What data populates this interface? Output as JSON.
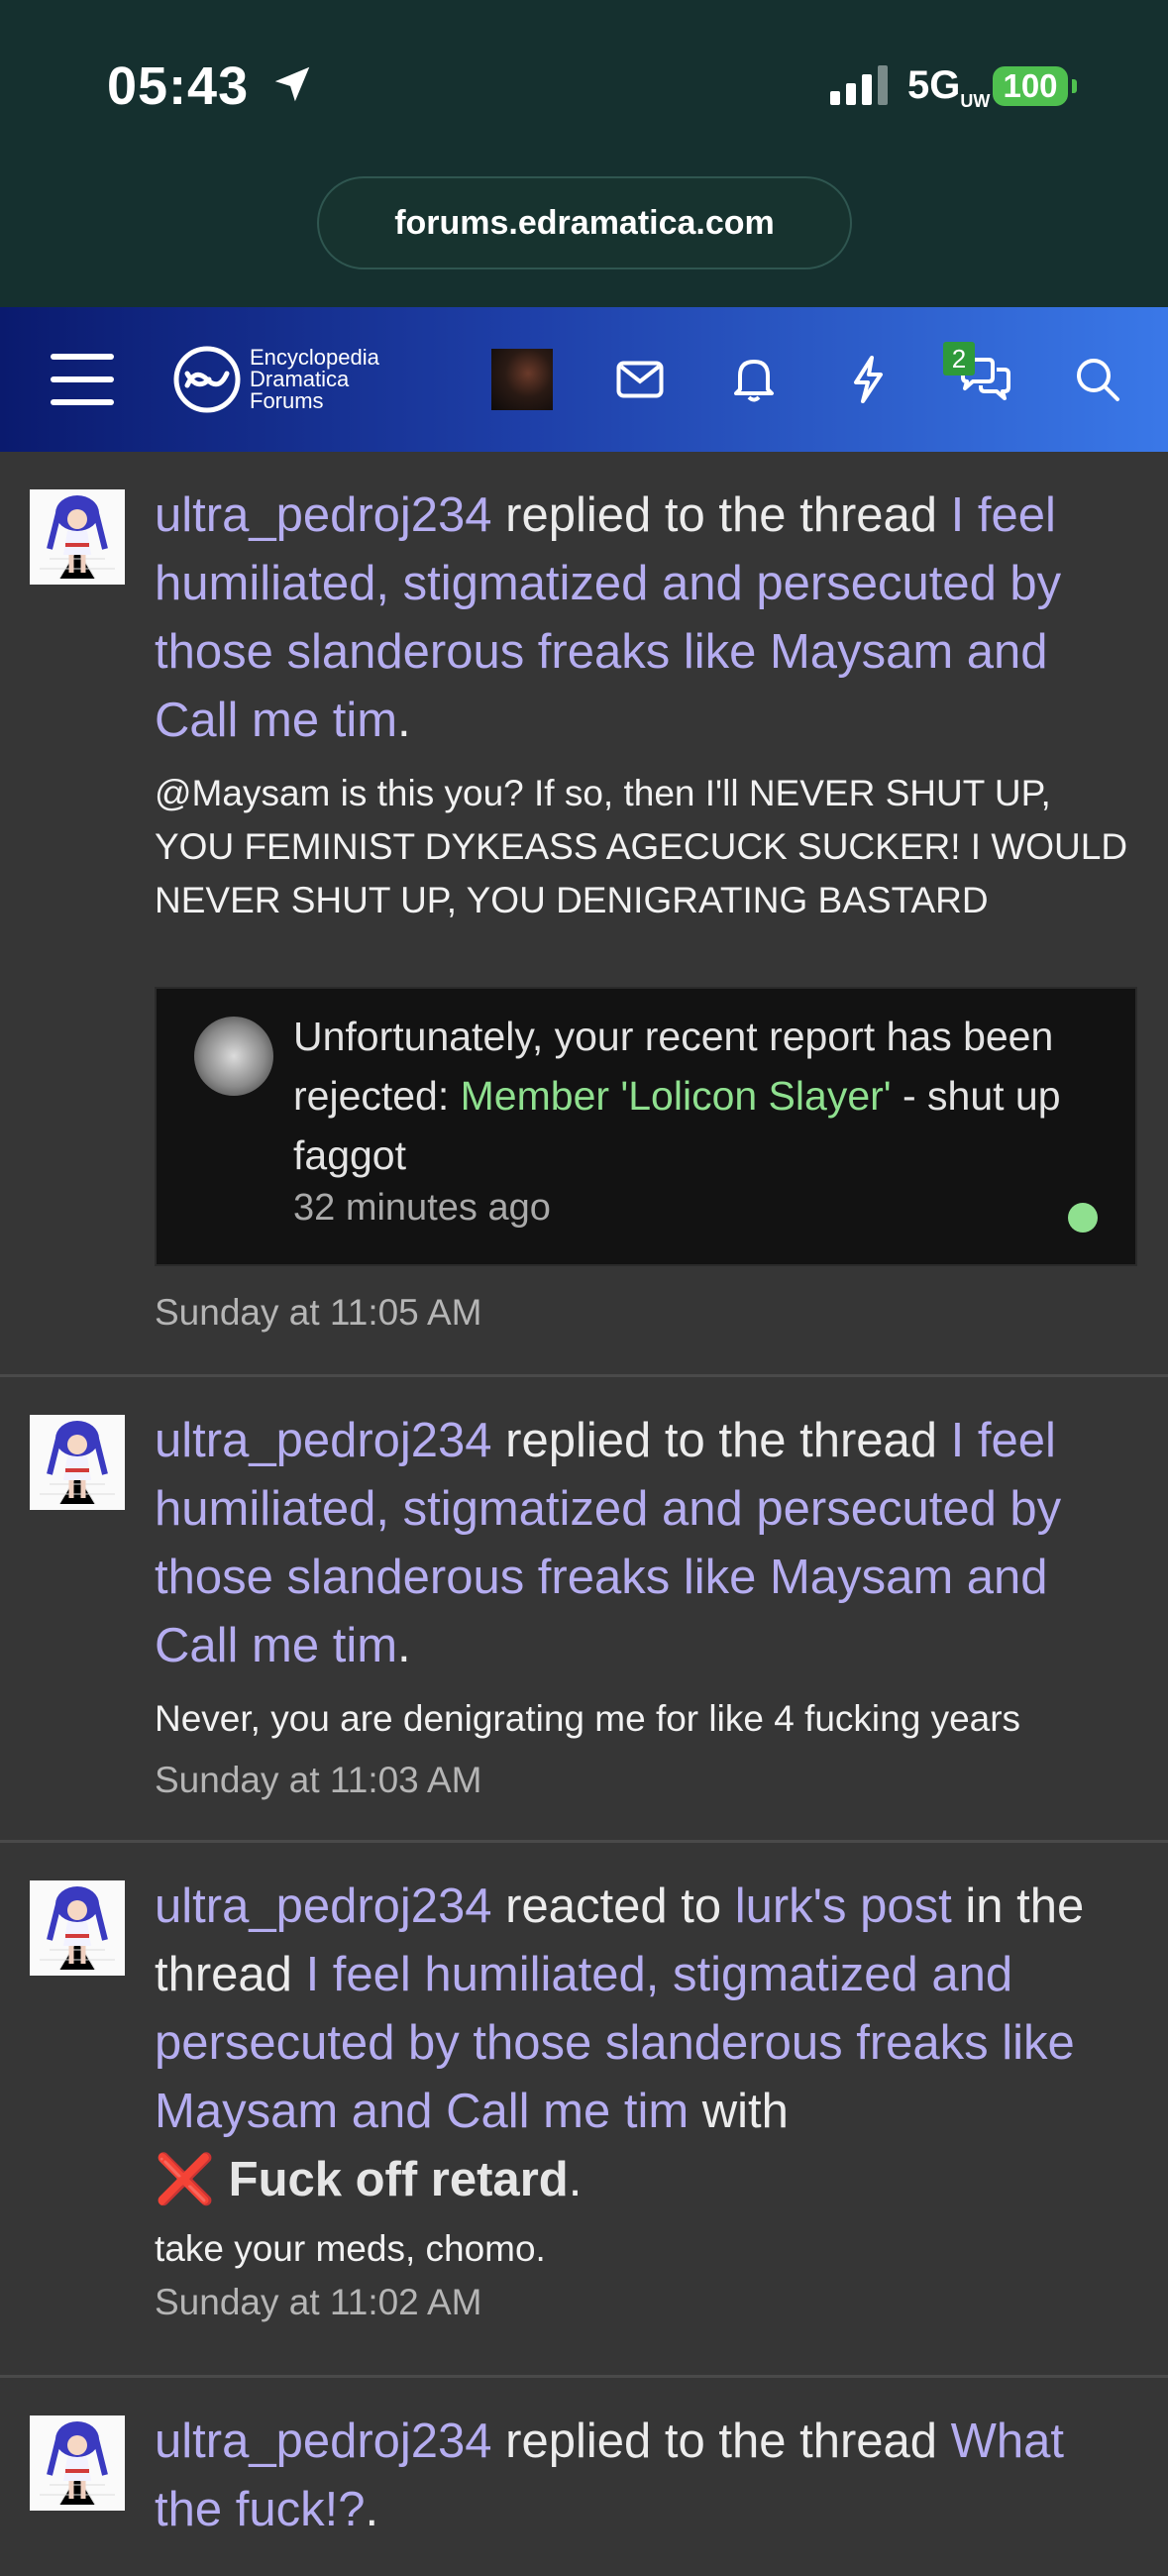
{
  "status": {
    "time": "05:43",
    "network": "5G",
    "network_sub": "UW",
    "battery": "100"
  },
  "browser": {
    "url": "forums.edramatica.com"
  },
  "navbar": {
    "logo_lines": [
      "Encyclopedia",
      "Dramatica",
      "Forums"
    ],
    "conversations_badge": "2"
  },
  "feed": [
    {
      "user": "ultra_pedroj234",
      "action": " replied to the thread ",
      "thread": "I feel humiliated, stigmatized and persecuted by those slanderous freaks like Maysam and Call me tim",
      "end": ".",
      "snippet": "@Maysam is this you? If so, then I'll NEVER SHUT UP, YOU FEMINIST DYKEASS AGECUCK SUCKER! I WOULD NEVER SHUT UP, YOU DENIGRATING BASTARD",
      "embed": {
        "text_1": "Unfortunately, your recent report has been rejected: ",
        "text_link": "Member 'Lolicon Slayer'",
        "text_2": " - shut up faggot",
        "ago": "32 minutes ago"
      },
      "time": "Sunday at 11:05 AM"
    },
    {
      "user": "ultra_pedroj234",
      "action": " replied to the thread ",
      "thread": "I feel humiliated, stigmatized and persecuted by those slanderous freaks like Maysam and Call me tim",
      "end": ".",
      "snippet": "Never, you are denigrating me for like 4 fucking years",
      "time": "Sunday at 11:03 AM"
    },
    {
      "user": "ultra_pedroj234",
      "action": " reacted to ",
      "post_link": "lurk's post",
      "mid": " in the thread ",
      "thread": "I feel humiliated, stigmatized and persecuted by those slanderous freaks like Maysam and Call me tim",
      "with": " with",
      "reaction_icon": "❌",
      "reaction": "Fuck off retard",
      "end": ".",
      "snippet": "take your meds, chomo.",
      "time": "Sunday at 11:02 AM"
    },
    {
      "user": "ultra_pedroj234",
      "action": " replied to the thread ",
      "thread": "What the fuck!?",
      "end": "."
    }
  ]
}
